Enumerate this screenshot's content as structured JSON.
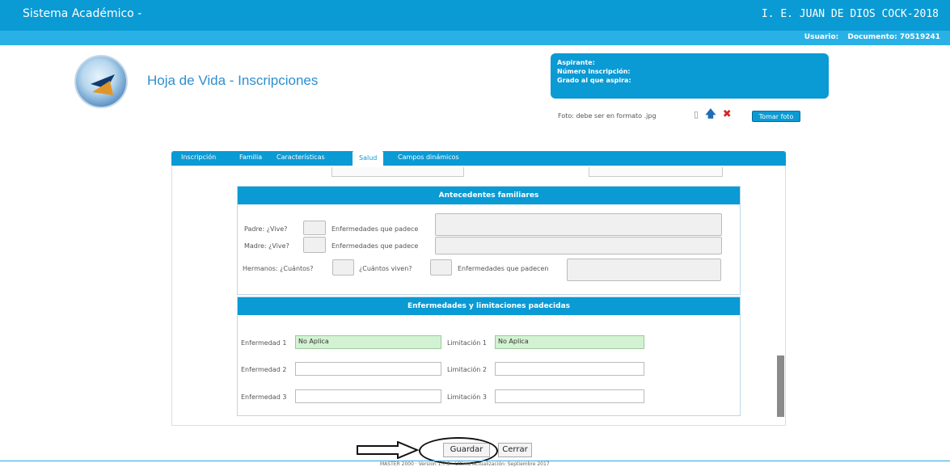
{
  "topbar": {
    "app_title": "Sistema Académico -",
    "school": "I. E. JUAN DE DIOS COCK-2018"
  },
  "userbar": {
    "user_label": "Usuario:",
    "document_label": "Documento: 70519241"
  },
  "page": {
    "title": "Hoja de Vida - Inscripciones"
  },
  "info_box": {
    "aspirante": "Aspirante:",
    "numero": "Número inscripción:",
    "grado": "Grado al que aspira:"
  },
  "photo": {
    "note": "Foto: debe ser en formato .jpg",
    "take_photo": "Tomar foto",
    "icons": [
      "paperclip-icon",
      "upload-arrow-icon",
      "delete-x-icon"
    ]
  },
  "tabs": [
    {
      "label": "Inscripción",
      "active": false
    },
    {
      "label": "Familia",
      "active": false
    },
    {
      "label": "Características",
      "active": false
    },
    {
      "label": "Salud",
      "active": true
    },
    {
      "label": "Campos dinámicos",
      "active": false
    }
  ],
  "antecedentes": {
    "header": "Antecedentes familiares",
    "padre_label": "Padre: ¿Vive?",
    "madre_label": "Madre: ¿Vive?",
    "padece_label": "Enfermedades que padece",
    "hermanos_label": "Hermanos: ¿Cuántos?",
    "cuantos_viven_label": "¿Cuántos viven?",
    "padecen_label": "Enfermedades que padecen"
  },
  "enfermedades": {
    "header": "Enfermedades y limitaciones padecidas",
    "enf1_label": "Enfermedad 1",
    "enf1_value": "No Aplica",
    "lim1_label": "Limitación 1",
    "lim1_value": "No Aplica",
    "enf2_label": "Enfermedad 2",
    "enf2_value": "",
    "lim2_label": "Limitación 2",
    "lim2_value": "",
    "enf3_label": "Enfermedad 3",
    "enf3_value": "",
    "lim3_label": "Limitación 3",
    "lim3_value": ""
  },
  "actions": {
    "guardar": "Guardar",
    "cerrar": "Cerrar"
  },
  "footer": {
    "text": "MASTER 2000 · Versión 1.7.3 · Última Actualización: Septiembre 2017"
  },
  "colors": {
    "primary": "#0a9ad4",
    "secondary": "#29b1e6",
    "filled_field": "#d3f2d3"
  }
}
